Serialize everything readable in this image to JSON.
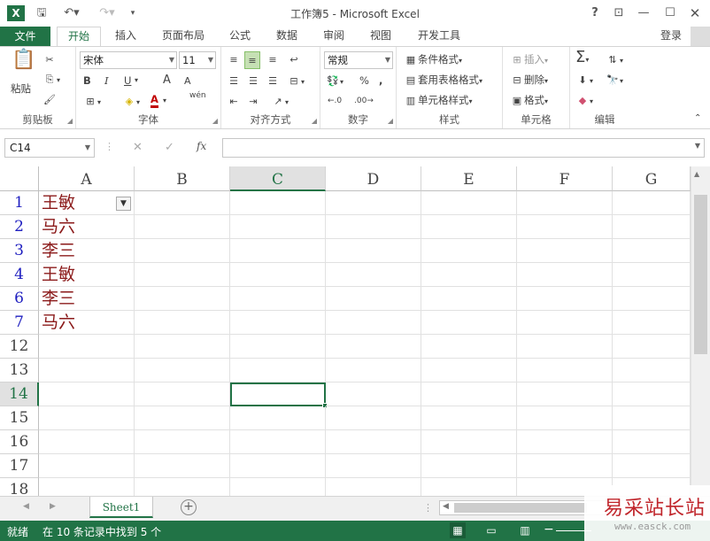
{
  "window": {
    "title": "工作簿5 - Microsoft Excel"
  },
  "tabs": {
    "file": "文件",
    "home": "开始",
    "insert": "插入",
    "layout": "页面布局",
    "formulas": "公式",
    "data": "数据",
    "review": "审阅",
    "view": "视图",
    "developer": "开发工具",
    "signin": "登录"
  },
  "ribbon": {
    "clipboard": {
      "label": "剪贴板",
      "paste": "粘贴"
    },
    "font": {
      "label": "字体",
      "name": "宋体",
      "size": "11",
      "bold": "B",
      "italic": "I",
      "underline": "U",
      "grow": "A",
      "shrink": "A",
      "color_letter": "A",
      "phonetic": "wén"
    },
    "alignment": {
      "label": "对齐方式"
    },
    "number": {
      "label": "数字",
      "format": "常规",
      "percent": "%",
      "comma": ","
    },
    "styles": {
      "label": "样式",
      "conditional": "条件格式",
      "table": "套用表格格式",
      "cell": "单元格样式"
    },
    "cells": {
      "label": "单元格",
      "insert": "插入",
      "delete": "删除",
      "format": "格式"
    },
    "editing": {
      "label": "编辑"
    }
  },
  "formula": {
    "namebox": "C14",
    "fx": "fx",
    "value": ""
  },
  "columns": [
    "A",
    "B",
    "C",
    "D",
    "E",
    "F",
    "G"
  ],
  "selected_column": "C",
  "rows": [
    {
      "num": "1",
      "a": "王敏",
      "filtered": true
    },
    {
      "num": "2",
      "a": "马六"
    },
    {
      "num": "3",
      "a": "李三"
    },
    {
      "num": "4",
      "a": "王敏"
    },
    {
      "num": "6",
      "a": "李三"
    },
    {
      "num": "7",
      "a": "马六"
    },
    {
      "num": "12",
      "a": ""
    },
    {
      "num": "13",
      "a": ""
    },
    {
      "num": "14",
      "a": "",
      "selected": true
    },
    {
      "num": "15",
      "a": ""
    },
    {
      "num": "16",
      "a": ""
    },
    {
      "num": "17",
      "a": ""
    },
    {
      "num": "18",
      "a": ""
    }
  ],
  "sheets": {
    "active": "Sheet1"
  },
  "status": {
    "ready": "就绪",
    "filter_msg": "在 10 条记录中找到 5 个"
  },
  "watermark": {
    "text": "易采站长站",
    "url": "www.easck.com"
  },
  "colors": {
    "excel_green": "#217346",
    "filtered_row_num": "#2020c0",
    "data_text": "#8b1a1a"
  }
}
